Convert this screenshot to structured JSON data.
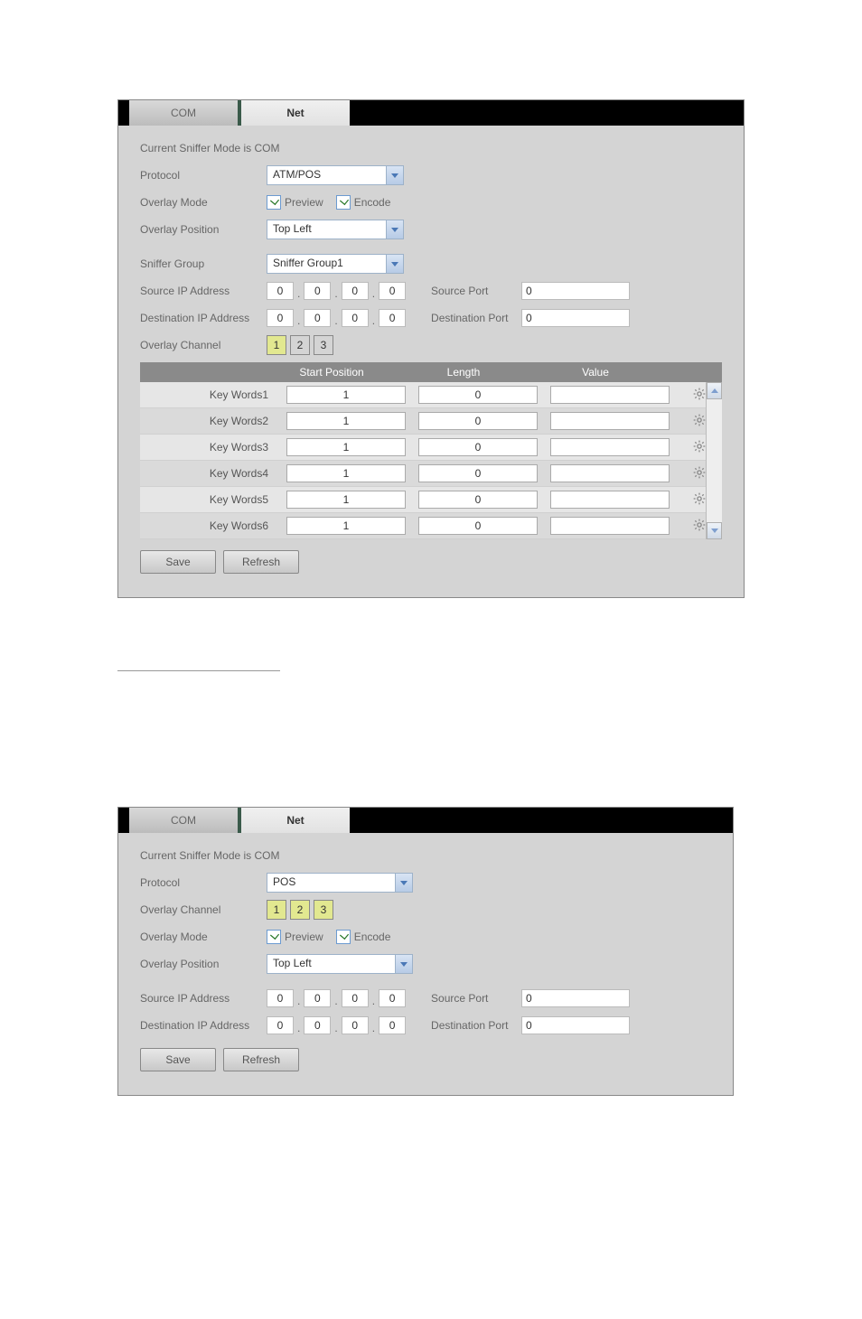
{
  "tabs": {
    "com": "COM",
    "net": "Net"
  },
  "mode_line": "Current Sniffer Mode is COM",
  "labels": {
    "protocol": "Protocol",
    "overlay_mode": "Overlay Mode",
    "overlay_position": "Overlay Position",
    "sniffer_group": "Sniffer Group",
    "source_ip": "Source IP Address",
    "dest_ip": "Destination IP Address",
    "overlay_channel": "Overlay Channel",
    "source_port": "Source Port",
    "dest_port": "Destination Port",
    "preview": "Preview",
    "encode": "Encode"
  },
  "panel1": {
    "protocol": "ATM/POS",
    "overlay_position": "Top Left",
    "sniffer_group": "Sniffer Group1",
    "source_ip": [
      "0",
      "0",
      "0",
      "0"
    ],
    "dest_ip": [
      "0",
      "0",
      "0",
      "0"
    ],
    "source_port": "0",
    "dest_port": "0",
    "channels": [
      "1",
      "2",
      "3"
    ],
    "channel_active": 0,
    "kw_headers": {
      "start": "Start Position",
      "length": "Length",
      "value": "Value"
    },
    "keywords": [
      {
        "name": "Key Words1",
        "start": "1",
        "length": "0",
        "alt": false
      },
      {
        "name": "Key Words2",
        "start": "1",
        "length": "0",
        "alt": true
      },
      {
        "name": "Key Words3",
        "start": "1",
        "length": "0",
        "alt": false
      },
      {
        "name": "Key Words4",
        "start": "1",
        "length": "0",
        "alt": true
      },
      {
        "name": "Key Words5",
        "start": "1",
        "length": "0",
        "alt": false
      },
      {
        "name": "Key Words6",
        "start": "1",
        "length": "0",
        "alt": true
      }
    ]
  },
  "panel2": {
    "protocol": "POS",
    "overlay_position": "Top Left",
    "channels": [
      "1",
      "2",
      "3"
    ],
    "source_ip": [
      "0",
      "0",
      "0",
      "0"
    ],
    "dest_ip": [
      "0",
      "0",
      "0",
      "0"
    ],
    "source_port": "0",
    "dest_port": "0"
  },
  "buttons": {
    "save": "Save",
    "refresh": "Refresh"
  }
}
